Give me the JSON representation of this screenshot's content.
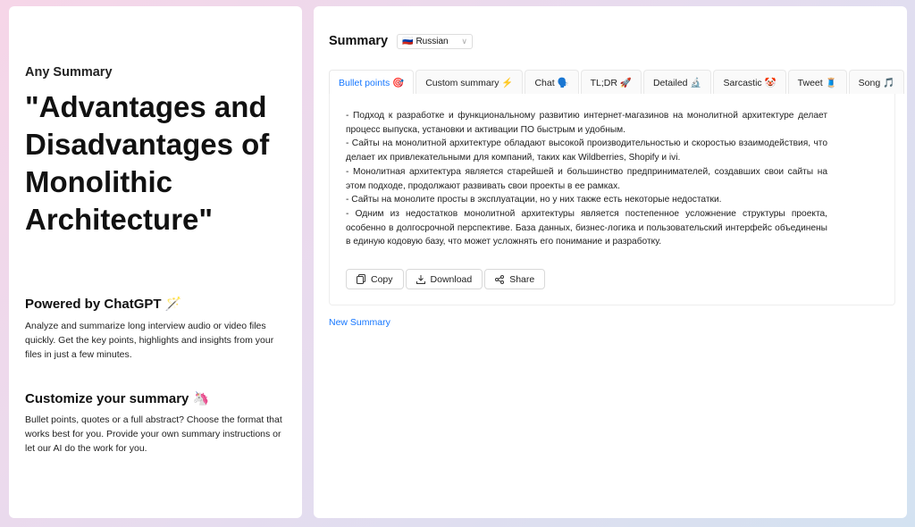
{
  "left": {
    "brand": "Any Summary",
    "title": "\"Advantages and Disadvantages of Monolithic Architecture\"",
    "powered_title": "Powered by ChatGPT 🪄",
    "powered_text": "Analyze and summarize long interview audio or video files quickly. Get the key points, highlights and insights from your files in just a few minutes.",
    "custom_title": "Customize your summary 🦄",
    "custom_text": "Bullet points, quotes or a full abstract? Choose the format that works best for you. Provide your own summary instructions or let our AI do the work for you."
  },
  "summary": {
    "heading": "Summary",
    "language": {
      "flag": "🇷🇺",
      "value": "Russian"
    }
  },
  "tabs": [
    {
      "label": "Bullet points 🎯"
    },
    {
      "label": "Custom summary ⚡"
    },
    {
      "label": "Chat 🗣️"
    },
    {
      "label": "TL;DR 🚀"
    },
    {
      "label": "Detailed 🔬"
    },
    {
      "label": "Sarcastic 🤡"
    },
    {
      "label": "Tweet 🧵"
    },
    {
      "label": "Song 🎵"
    }
  ],
  "active_tab": "Bullet points 🎯",
  "bullets": [
    "- Подход к разработке и функциональному развитию интернет-магазинов на монолитной архитектуре делает процесс выпуска, установки и активации ПО быстрым и удобным.",
    "- Сайты на монолитной архитектуре обладают высокой производительностью и скоростью взаимодействия, что делает их привлекательными для компаний, таких как Wildberries, Shopify и ivi.",
    "- Монолитная архитектура является старейшей и большинство предпринимателей, создавших свои сайты на этом подходе, продолжают развивать свои проекты в ее рамках.",
    "- Сайты на монолите просты в эксплуатации, но у них также есть некоторые недостатки.",
    "- Одним из недостатков монолитной архитектуры является постепенное усложнение структуры проекта, особенно в долгосрочной перспективе. База данных, бизнес-логика и пользовательский интерфейс объединены в единую кодовую базу, что может усложнять его понимание и разработку."
  ],
  "actions": {
    "copy": "Copy",
    "download": "Download",
    "share": "Share"
  },
  "new_summary": "New Summary",
  "colors": {
    "accent": "#1677ff"
  }
}
